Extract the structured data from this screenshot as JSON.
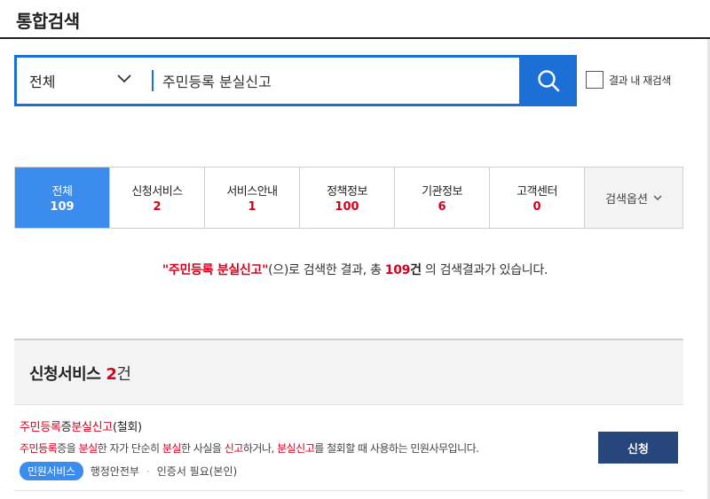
{
  "page": {
    "title": "통합검색"
  },
  "search": {
    "scope": "전체",
    "query": "주민등록 분실신고",
    "research_label": "결과 내 재검색"
  },
  "tabs": [
    {
      "label": "전체",
      "count": "109"
    },
    {
      "label": "신청서비스",
      "count": "2"
    },
    {
      "label": "서비스안내",
      "count": "1"
    },
    {
      "label": "정책정보",
      "count": "100"
    },
    {
      "label": "기관정보",
      "count": "6"
    },
    {
      "label": "고객센터",
      "count": "0"
    }
  ],
  "tab_options_label": "검색옵션",
  "summary": {
    "query_quoted": "\"주민등록 분실신고\"",
    "text_mid": "(으)로 검색한 결과, 총 ",
    "count": "109",
    "unit": "건",
    "text_end": " 의 검색결과가 있습니다."
  },
  "section": {
    "title": "신청서비스",
    "count": "2",
    "unit": "건"
  },
  "result": {
    "title_parts": [
      "주민등록",
      "증",
      "분실신고",
      "(철회)"
    ],
    "desc_parts": [
      "주민등록",
      "증을 ",
      "분실",
      "한 자가 단순히 ",
      "분실",
      "한 사실을 ",
      "신고",
      "하거나, ",
      "분실신고",
      "를 철회할 때 사용하는 민원사무입니다."
    ],
    "badge": "민원서비스",
    "agency": "행정안전부",
    "auth": "인증서 필요(본인)",
    "apply_label": "신청"
  },
  "colors": {
    "accent": "#1c6fd5",
    "active_tab": "#3b8ced",
    "highlight": "#d6001c",
    "button": "#27467b"
  }
}
